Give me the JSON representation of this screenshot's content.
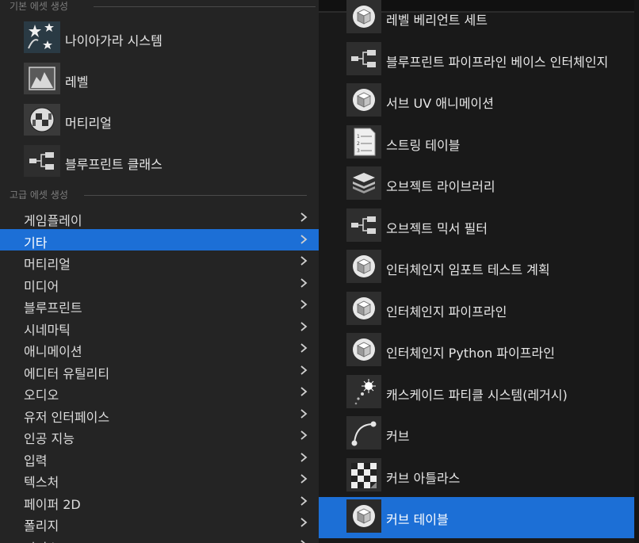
{
  "left_panel": {
    "basic_section": "기본 에셋 생성",
    "basic_assets": [
      {
        "label": "나이아가라 시스템",
        "icon": "niagara-system-icon",
        "color": "#1ab0e6"
      },
      {
        "label": "레벨",
        "icon": "level-icon",
        "color": "#f0a020"
      },
      {
        "label": "머티리얼",
        "icon": "material-icon",
        "color": "#3cb43c"
      },
      {
        "label": "블루프린트 클래스",
        "icon": "blueprint-class-icon",
        "color": "#3a72e8"
      }
    ],
    "advanced_section": "고급 에셋 생성",
    "categories": [
      {
        "label": "게임플레이"
      },
      {
        "label": "기타"
      },
      {
        "label": "머티리얼"
      },
      {
        "label": "미디어"
      },
      {
        "label": "블루프린트"
      },
      {
        "label": "시네마틱"
      },
      {
        "label": "애니메이션"
      },
      {
        "label": "에디터 유틸리티"
      },
      {
        "label": "오디오"
      },
      {
        "label": "유저 인터페이스"
      },
      {
        "label": "인공 지능"
      },
      {
        "label": "입력"
      },
      {
        "label": "텍스처"
      },
      {
        "label": "페이퍼 2D"
      },
      {
        "label": "폴리지"
      },
      {
        "label": "피지스"
      }
    ],
    "selected_category": "기타"
  },
  "right_panel": {
    "items": [
      {
        "label": "레벨 베리언트 세트",
        "icon": "cube-icon",
        "color": "#4a3cc8"
      },
      {
        "label": "블루프린트 파이프라인 베이스 인터체인지",
        "icon": "blueprint-node-icon",
        "color": "#2a2adc"
      },
      {
        "label": "서브 UV 애니메이션",
        "icon": "cube-icon",
        "color": "#ffffff"
      },
      {
        "label": "스트링 테이블",
        "icon": "string-table-icon",
        "color": "#f0b488"
      },
      {
        "label": "오브젝트 라이브러리",
        "icon": "object-library-icon",
        "color": "#e04a6a"
      },
      {
        "label": "오브젝트 믹서 필터",
        "icon": "blueprint-node-icon",
        "color": "#3a6ae8"
      },
      {
        "label": "인터체인지 임포트 테스트 계획",
        "icon": "cube-icon",
        "color": "#8a22c8"
      },
      {
        "label": "인터체인지 파이프라인",
        "icon": "cube-icon",
        "color": "#8ac82a"
      },
      {
        "label": "인터체인지 Python 파이프라인",
        "icon": "cube-icon",
        "color": "#8ac82a"
      },
      {
        "label": "캐스케이드 파티클 시스템(레거시)",
        "icon": "cascade-particle-icon",
        "color": "#ffffff"
      },
      {
        "label": "커브",
        "icon": "curve-icon",
        "color": "#5a2ac8"
      },
      {
        "label": "커브 아틀라스",
        "icon": "checker-icon",
        "color": "#a83232"
      },
      {
        "label": "커브 테이블",
        "icon": "cube-icon",
        "color": "#3cb43c"
      }
    ],
    "selected_item": "커브 테이블"
  }
}
